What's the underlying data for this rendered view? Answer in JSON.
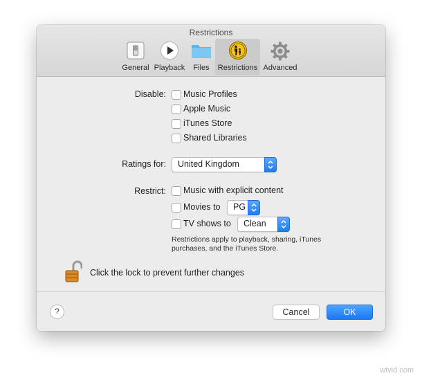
{
  "window": {
    "title": "Restrictions"
  },
  "tabs": [
    {
      "label": "General",
      "icon": "switch-icon",
      "selected": false
    },
    {
      "label": "Playback",
      "icon": "play-icon",
      "selected": false
    },
    {
      "label": "Files",
      "icon": "folder-icon",
      "selected": false
    },
    {
      "label": "Restrictions",
      "icon": "parental-controls-icon",
      "selected": true
    },
    {
      "label": "Advanced",
      "icon": "gear-icon",
      "selected": false
    }
  ],
  "disable": {
    "label": "Disable:",
    "options": [
      {
        "label": "Music Profiles",
        "checked": false
      },
      {
        "label": "Apple Music",
        "checked": false
      },
      {
        "label": "iTunes Store",
        "checked": false
      },
      {
        "label": "Shared Libraries",
        "checked": false
      }
    ]
  },
  "ratings": {
    "label": "Ratings for:",
    "selected": "United Kingdom"
  },
  "restrict": {
    "label": "Restrict:",
    "explicit_label": "Music with explicit content",
    "movies_label": "Movies to",
    "movies_value": "PG",
    "tv_label": "TV shows to",
    "tv_value": "Clean",
    "note": "Restrictions apply to playback, sharing, iTunes purchases, and the iTunes Store."
  },
  "lock": {
    "text": "Click the lock to prevent further changes"
  },
  "footer": {
    "help_label": "?",
    "cancel_label": "Cancel",
    "ok_label": "OK"
  },
  "watermark": "wtvid.com",
  "colors": {
    "accent": "#1b78f2",
    "window_bg": "#ececec"
  }
}
